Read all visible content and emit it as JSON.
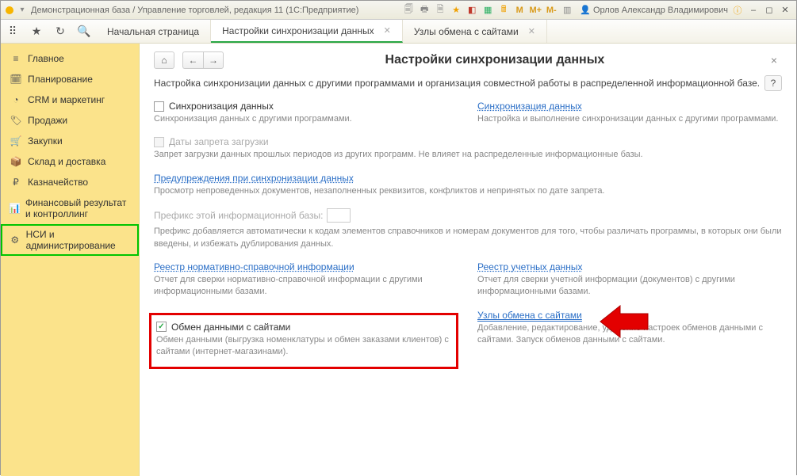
{
  "titlebar": {
    "title": "Демонстрационная база / Управление торговлей, редакция 11 (1С:Предприятие)",
    "user": "Орлов Александр Владимирович",
    "m_labels": [
      "M",
      "M+",
      "M-"
    ]
  },
  "topnav": {
    "tabs": [
      {
        "label": "Начальная страница",
        "active": false,
        "closable": false
      },
      {
        "label": "Настройки синхронизации данных",
        "active": true,
        "closable": true
      },
      {
        "label": "Узлы обмена с сайтами",
        "active": false,
        "closable": true
      }
    ]
  },
  "sidebar": {
    "items": [
      {
        "icon": "≡",
        "label": "Главное"
      },
      {
        "icon": "🗓",
        "label": "Планирование"
      },
      {
        "icon": "◔",
        "label": "CRM и маркетинг"
      },
      {
        "icon": "🏷",
        "label": "Продажи"
      },
      {
        "icon": "🛒",
        "label": "Закупки"
      },
      {
        "icon": "📦",
        "label": "Склад и доставка"
      },
      {
        "icon": "₽",
        "label": "Казначейство"
      },
      {
        "icon": "📊",
        "label": "Финансовый результат и контроллинг"
      },
      {
        "icon": "⚙",
        "label": "НСИ и администрирование",
        "selected": true
      }
    ]
  },
  "page": {
    "title": "Настройки синхронизации данных",
    "intro": "Настройка синхронизации данных с другими программами и организация совместной работы в распределенной информационной базе.",
    "help": "?",
    "sync_checkbox_label": "Синхронизация данных",
    "sync_desc": "Синхронизация данных с другими программами.",
    "sync_link": "Синхронизация данных",
    "sync_link_desc": "Настройка и выполнение синхронизации данных с другими программами.",
    "dates_label": "Даты запрета загрузки",
    "dates_desc": "Запрет загрузки данных прошлых периодов из других программ. Не влияет на распределенные информационные базы.",
    "warn_link": "Предупреждения при синхронизации данных",
    "warn_desc": "Просмотр непроведенных документов, незаполненных реквизитов, конфликтов и непринятых по дате запрета.",
    "prefix_label": "Префикс этой информационной базы:",
    "prefix_desc": "Префикс добавляется автоматически к кодам элементов справочников и номерам документов для того, чтобы различать программы, в которых они были введены, и избежать дублирования данных.",
    "registry_nsi_link": "Реестр нормативно-справочной информации",
    "registry_nsi_desc": "Отчет для сверки нормативно-справочной информации с другими информационными базами.",
    "registry_acc_link": "Реестр учетных данных",
    "registry_acc_desc": "Отчет для сверки учетной информации (документов) с другими информационными базами.",
    "exchange_label": "Обмен данными с сайтами",
    "exchange_desc": "Обмен данными (выгрузка номенклатуры и обмен заказами клиентов) с сайтами (интернет-магазинами).",
    "nodes_link": "Узлы обмена с сайтами",
    "nodes_desc": "Добавление, редактирование, удаление настроек обменов данными с сайтами. Запуск обменов данными с сайтами."
  }
}
